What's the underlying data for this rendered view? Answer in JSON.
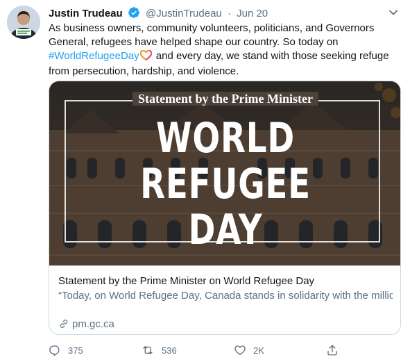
{
  "tweet": {
    "author_name": "Justin Trudeau",
    "handle": "@JustinTrudeau",
    "separator": "·",
    "date": "Jun 20",
    "text_part1": "As business owners, community volunteers, politicians, and Governors General, refugees have helped shape our country. So today on ",
    "hashtag": "#WorldRefugeeDay",
    "text_part2": " and every day, we stand with those seeking refuge from persecution, hardship, and violence."
  },
  "card": {
    "image": {
      "heading": "Statement by the Prime Minister",
      "line1": "WORLD",
      "line2": "REFUGEE",
      "line3": "DAY"
    },
    "title": "Statement by the Prime Minister on World Refugee Day",
    "description": "“Today, on World Refugee Day, Canada stands in solidarity with the millions of people around the world who long for what is often taken fo...",
    "domain": "pm.gc.ca"
  },
  "actions": {
    "reply_count": "375",
    "retweet_count": "536",
    "like_count": "2K"
  },
  "icons": {
    "verified": "verified-badge-icon",
    "caret": "chevron-down-icon",
    "reply": "reply-icon",
    "retweet": "retweet-icon",
    "like": "heart-icon",
    "share": "share-icon",
    "link": "link-icon"
  },
  "colors": {
    "accent": "#1da1f2",
    "secondary_text": "#5b7083",
    "border": "#cfd9de"
  }
}
